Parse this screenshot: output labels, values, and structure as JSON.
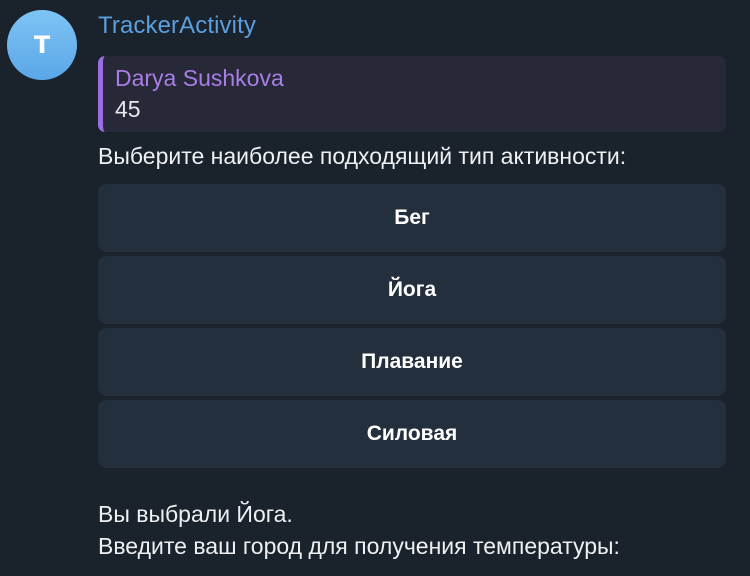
{
  "avatar": {
    "letter": "T"
  },
  "message": {
    "sender": "TrackerActivity",
    "reply": {
      "name": "Darya Sushkova",
      "text": "45"
    },
    "prompt": "Выберите наиболее подходящий тип активности:",
    "buttons": [
      {
        "label": "Бег"
      },
      {
        "label": "Йога"
      },
      {
        "label": "Плавание"
      },
      {
        "label": "Силовая"
      }
    ]
  },
  "followup": {
    "line1": "Вы выбрали Йога.",
    "line2": "Введите ваш город для получения температуры:"
  },
  "colors": {
    "background": "#1a222c",
    "sender": "#5b9fdf",
    "reply_accent": "#9b6de0",
    "button_bg": "#242f3d"
  }
}
